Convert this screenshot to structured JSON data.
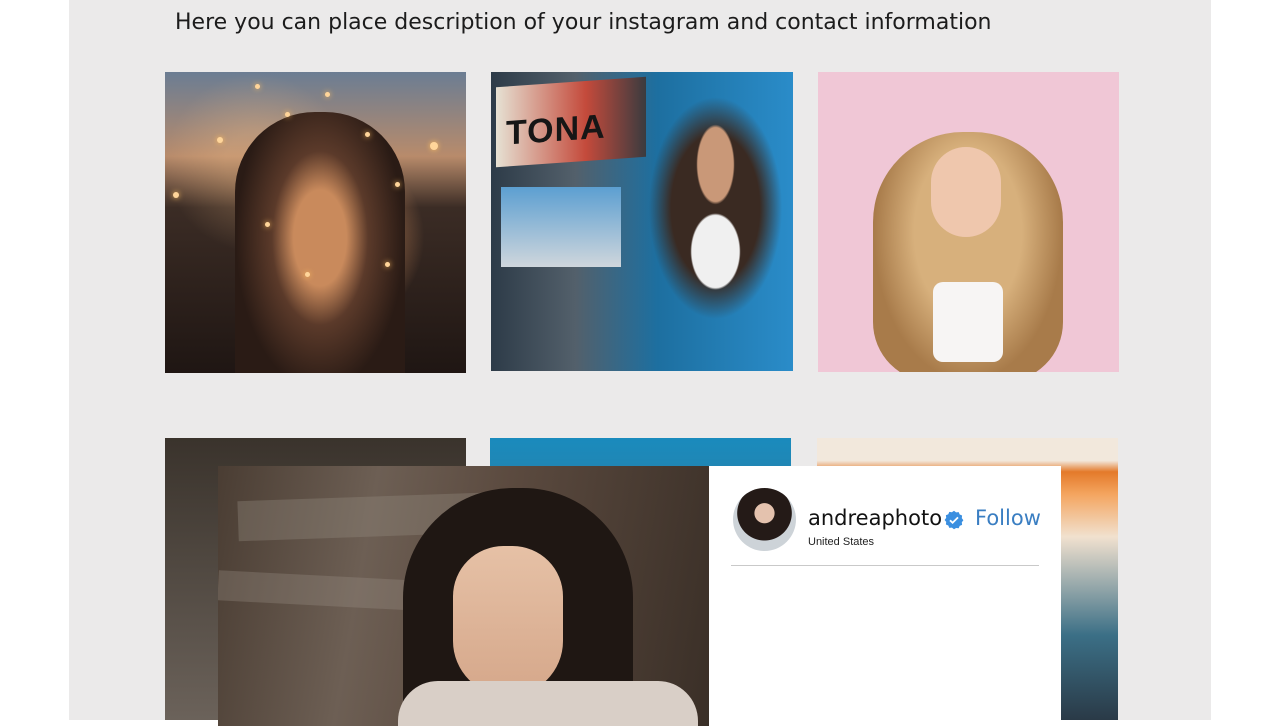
{
  "header": {
    "description": "Here you can place description of your instagram and contact information"
  },
  "gallery": {
    "tiles": [
      {
        "name": "fairy-lights-portrait"
      },
      {
        "name": "arcade-portrait",
        "sign_text": "TONA"
      },
      {
        "name": "pink-background-portrait"
      },
      {
        "name": "dark-room-portrait"
      },
      {
        "name": "blue-light-portrait"
      },
      {
        "name": "sunset-window-portrait"
      }
    ]
  },
  "post_modal": {
    "username": "andreaphoto",
    "location": "United States",
    "follow_label": "Follow",
    "verified_color": "#3b8fe0",
    "link_color": "#3a7ec2",
    "icons": {
      "verified": "verified-badge-icon"
    }
  }
}
